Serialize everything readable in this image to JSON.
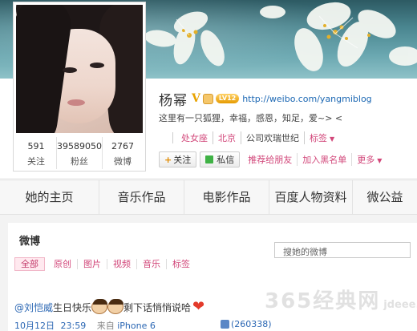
{
  "profile": {
    "name": "杨幂",
    "verified_mark": "V",
    "level_badge": "LV12",
    "blog_url": "http://weibo.com/yangmiblog",
    "bio": "这里有一只狐狸，幸福，感恩，知足，爱~> <",
    "tags": [
      "处女座",
      "北京",
      "公司欢瑞世纪",
      "标签"
    ],
    "stats": [
      {
        "value": "591",
        "label": "关注"
      },
      {
        "value": "39589050",
        "label": "粉丝"
      },
      {
        "value": "2767",
        "label": "微博"
      }
    ]
  },
  "actions": {
    "follow": "关注",
    "message": "私信",
    "recommend": "推荐给朋友",
    "blacklist": "加入黑名单",
    "more": "更多"
  },
  "nav": {
    "tabs": [
      "她的主页",
      "音乐作品",
      "电影作品",
      "百度人物资料",
      "微公益"
    ]
  },
  "feed": {
    "title": "微博",
    "search_placeholder": "搜她的微博",
    "filters": [
      "全部",
      "原创",
      "图片",
      "视频",
      "音乐",
      "标签"
    ]
  },
  "post": {
    "mention": "@刘恺威",
    "text_before": " 生日快乐",
    "text_after": "剩下话悄悄说哈",
    "date": "10月12日",
    "time": "23:59",
    "source_label": "来自",
    "source": "iPhone 6",
    "likes": "(260338)"
  },
  "watermark": {
    "text": "365经典网",
    "domain": "jdeee.cn"
  },
  "colors": {
    "accent_pink": "#d2477a",
    "link_blue": "#2a66b3",
    "gold": "#e8a300"
  }
}
